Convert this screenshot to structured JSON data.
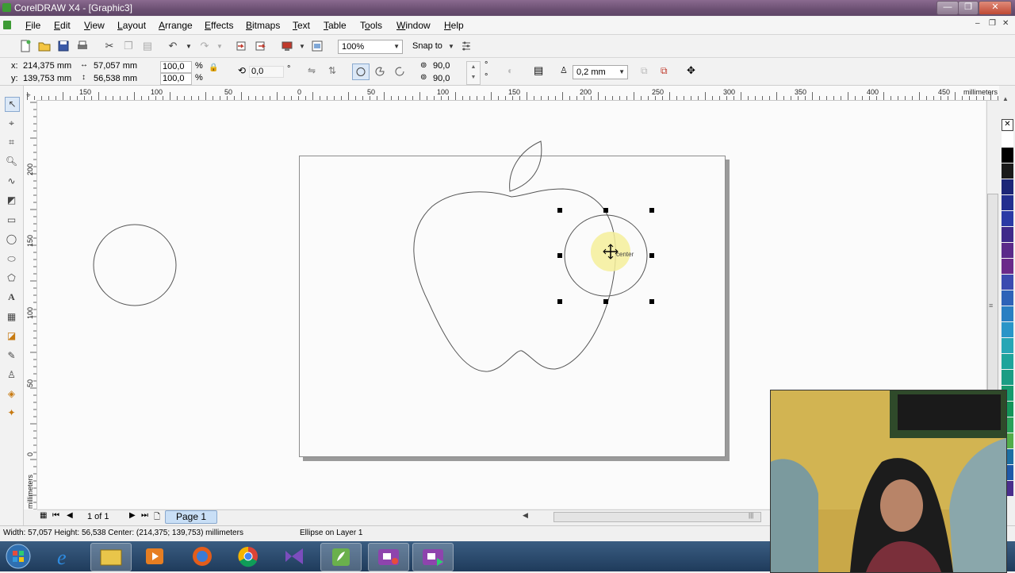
{
  "window": {
    "title": "CorelDRAW X4 - [Graphic3]",
    "buttons": {
      "minimize": "—",
      "maximize": "❐",
      "close": "✕"
    }
  },
  "menu": {
    "items": [
      "File",
      "Edit",
      "View",
      "Layout",
      "Arrange",
      "Effects",
      "Bitmaps",
      "Text",
      "Table",
      "Tools",
      "Window",
      "Help"
    ],
    "mnemonics": [
      "F",
      "E",
      "V",
      "L",
      "A",
      "E",
      "B",
      "T",
      "T",
      "o",
      "W",
      "H"
    ]
  },
  "toolbar": {
    "zoom_value": "100%",
    "snap_label": "Snap to",
    "icons": [
      "new-icon",
      "open-icon",
      "save-icon",
      "print-icon",
      "cut-icon",
      "copy-icon",
      "paste-icon",
      "undo-icon",
      "redo-icon",
      "import-icon",
      "export-icon",
      "app-launcher-icon",
      "welcome-screen-icon",
      "zoom-dropdown",
      "snap-to-dropdown",
      "options-icon"
    ]
  },
  "properties": {
    "x_label": "x:",
    "x_value": "214,375 mm",
    "y_label": "y:",
    "y_value": "139,753 mm",
    "width_value": "57,057 mm",
    "height_value": "56,538 mm",
    "scale_x": "100,0",
    "scale_y": "100,0",
    "percent": "%",
    "rotation": "0,0",
    "degree": "°",
    "start_angle": "90,0",
    "end_angle": "90,0",
    "outline_width": "0,2 mm"
  },
  "rulers": {
    "unit": "millimeters",
    "h_ticks": [
      "150",
      "100",
      "50",
      "0",
      "50",
      "100",
      "150",
      "200",
      "250",
      "300",
      "350",
      "400",
      "450"
    ],
    "v_ticks": [
      "200",
      "150",
      "100",
      "50",
      "0"
    ]
  },
  "canvas": {
    "tooltip_label": "center"
  },
  "navigator": {
    "page_count": "1 of 1",
    "page_tab": "Page 1"
  },
  "status": {
    "dimensions": "Width: 57,057  Height: 56,538  Center: (214,375; 139,753)  millimeters",
    "selection": "Ellipse on Layer 1"
  },
  "palette": {
    "colors": [
      "#ffffff",
      "#000000",
      "#1a1a1a",
      "#1c2677",
      "#232f8f",
      "#2a3aa5",
      "#3f2a8a",
      "#5b2a8a",
      "#6a2a8a",
      "#3b4bb0",
      "#2e63b8",
      "#2a7fc2",
      "#2a95c8",
      "#27a6b5",
      "#1ea49b",
      "#1b9d84",
      "#179a6d",
      "#14955a",
      "#2aa15a",
      "#52ad4a",
      "#1d6fa3",
      "#1e59a8",
      "#4a2e8c"
    ]
  },
  "taskbar": {
    "apps": [
      "start-button",
      "internet-explorer-icon",
      "file-explorer-icon",
      "media-player-icon",
      "firefox-icon",
      "chrome-icon",
      "visual-studio-icon",
      "coreldraw-icon",
      "video-recorder-icon",
      "video-player-icon"
    ]
  }
}
